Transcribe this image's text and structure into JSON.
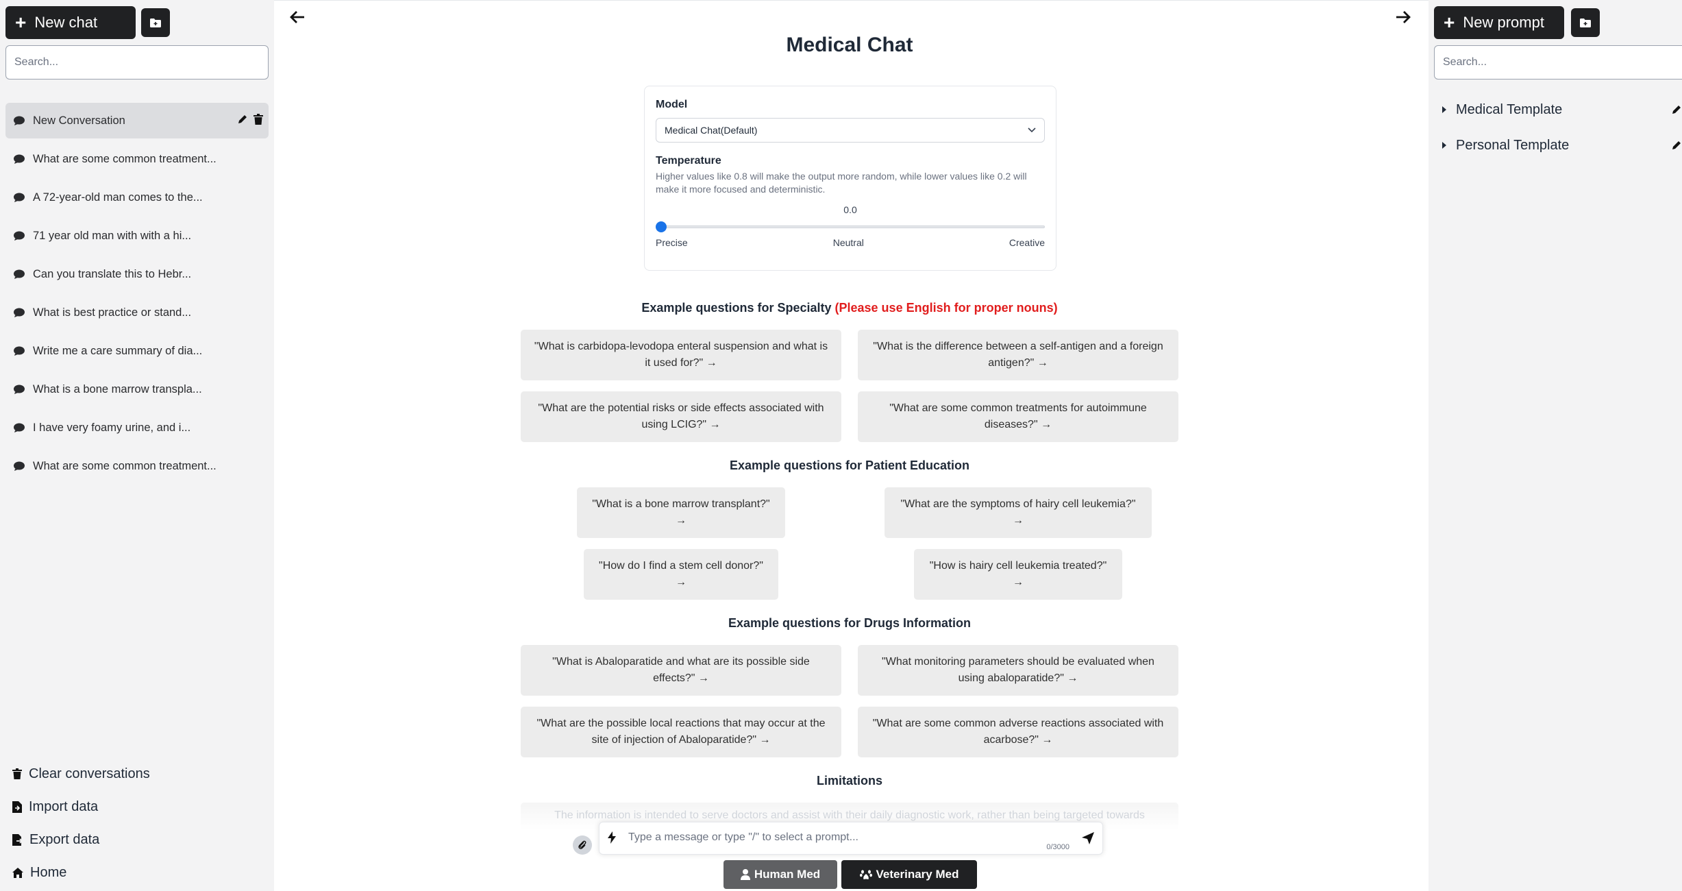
{
  "left_sidebar": {
    "new_chat_label": "New chat",
    "search_placeholder": "Search...",
    "conversations": [
      "New Conversation",
      "What are some common treatment...",
      "A 72-year-old man comes to the...",
      "71 year old man with with a hi...",
      "Can you translate this to Hebr...",
      "What is best practice or stand...",
      "Write me a care summary of dia...",
      "What is a bone marrow transpla...",
      "I have very foamy urine, and i...",
      "What are some common treatment..."
    ],
    "bottom_menu": {
      "clear": "Clear conversations",
      "import": "Import data",
      "export": "Export data",
      "home": "Home"
    }
  },
  "main": {
    "title": "Medical Chat",
    "settings": {
      "model_label": "Model",
      "model_value": "Medical Chat(Default)",
      "temperature_label": "Temperature",
      "temperature_desc": "Higher values like 0.8 will make the output more random, while lower values like 0.2 will make it more focused and deterministic.",
      "temperature_value": "0.0",
      "slider_fraction": 0.0,
      "slider_labels": {
        "left": "Precise",
        "center": "Neutral",
        "right": "Creative"
      }
    },
    "specialty": {
      "heading": "Example questions for Specialty",
      "note": "(Please use English for proper nouns)",
      "questions": [
        "\"What is carbidopa-levodopa enteral suspension and what is it used for?\" →",
        "\"What is the difference between a self-antigen and a foreign antigen?\" →",
        "\"What are the potential risks or side effects associated with using LCIG?\" →",
        "\"What are some common treatments for autoimmune diseases?\" →"
      ]
    },
    "patient_education": {
      "heading": "Example questions for Patient Education",
      "questions": [
        "\"What is a bone marrow transplant?\" →",
        "\"What are the symptoms of hairy cell leukemia?\" →",
        "\"How do I find a stem cell donor?\" →",
        "\"How is hairy cell leukemia treated?\" →"
      ]
    },
    "drugs": {
      "heading": "Example questions for Drugs Information",
      "questions": [
        "\"What is Abaloparatide and what are its possible side effects?\" →",
        "\"What monitoring parameters should be evaluated when using abaloparatide?\" →",
        "\"What are the possible local reactions that may occur at the site of injection of Abaloparatide?\" →",
        "\"What are some common adverse reactions associated with acarbose?\" →"
      ]
    },
    "limitations": {
      "heading": "Limitations",
      "text": "The information is intended to serve doctors and assist with their daily diagnostic work, rather than being targeted towards"
    },
    "chat_input": {
      "placeholder": "Type a message or type \"/\" to select a prompt...",
      "counter": "0/3000"
    },
    "modes": {
      "human": "Human Med",
      "vet": "Veterinary Med"
    }
  },
  "right_sidebar": {
    "new_prompt_label": "New prompt",
    "search_placeholder": "Search...",
    "folders": [
      "Medical Template",
      "Personal Template"
    ]
  },
  "colors": {
    "accent_blue": "#1a73e8",
    "warning_red": "#e11d1d",
    "dark_button": "#202123",
    "sidebar_bg": "#f3f3f4"
  }
}
